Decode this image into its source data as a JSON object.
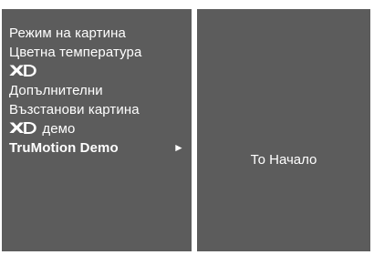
{
  "menu": {
    "items": [
      {
        "label": "Режим на картина"
      },
      {
        "label": "Цветна температура"
      },
      {
        "logo": "xd-logo"
      },
      {
        "label": "Допълнителни"
      },
      {
        "label": "Възстанови картина"
      },
      {
        "logo": "xd-logo",
        "label": "демо"
      },
      {
        "label": "TruMotion Demo",
        "selected": true,
        "arrow": "►"
      }
    ]
  },
  "submenu": {
    "label": "То Начало"
  },
  "colors": {
    "panel": "#5c5c5c",
    "text": "#ffffff",
    "border": "#ffffff"
  }
}
